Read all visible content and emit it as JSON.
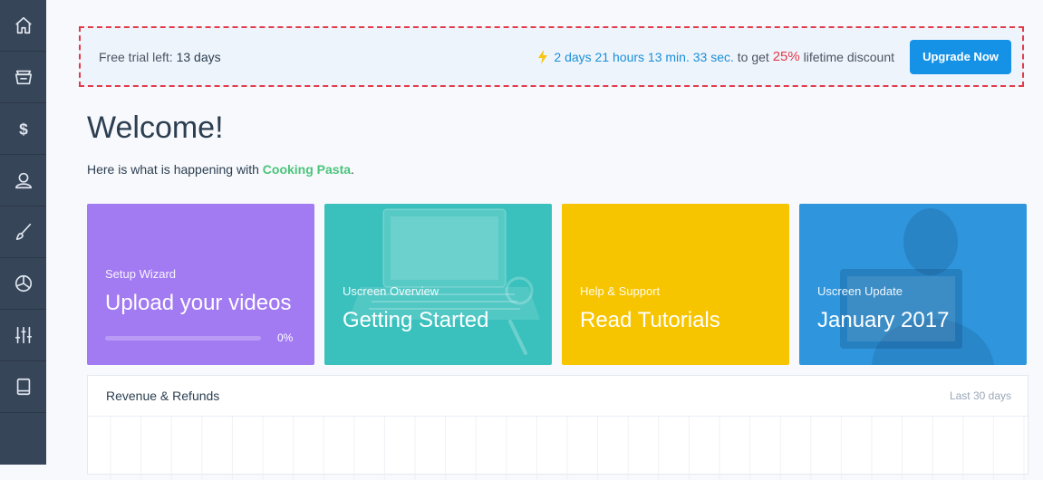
{
  "sidebar": {
    "items": [
      {
        "name": "home",
        "icon": "home-icon"
      },
      {
        "name": "catalog",
        "icon": "basket-icon"
      },
      {
        "name": "sales",
        "icon": "dollar-icon"
      },
      {
        "name": "people",
        "icon": "user-icon"
      },
      {
        "name": "design",
        "icon": "brush-icon"
      },
      {
        "name": "analytics",
        "icon": "pie-chart-icon"
      },
      {
        "name": "settings",
        "icon": "sliders-icon"
      },
      {
        "name": "apps",
        "icon": "tablet-icon"
      }
    ]
  },
  "trial": {
    "label": "Free trial left:",
    "days": "13 days",
    "countdown": "2 days 21 hours 13 min. 33 sec.",
    "to_get": "to get",
    "discount": "25%",
    "discount_suffix": "lifetime discount",
    "upgrade_label": "Upgrade Now"
  },
  "welcome": {
    "title": "Welcome!",
    "subtitle_prefix": "Here is what is happening with",
    "channel": "Cooking Pasta",
    "subtitle_suffix": "."
  },
  "cards": [
    {
      "overline": "Setup Wizard",
      "title": "Upload your videos",
      "progress": 0,
      "progress_label": "0%",
      "color": "#a27af2"
    },
    {
      "overline": "Uscreen Overview",
      "title": "Getting Started",
      "color": "#3bc1bd"
    },
    {
      "overline": "Help & Support",
      "title": "Read Tutorials",
      "color": "#f7c500"
    },
    {
      "overline": "Uscreen Update",
      "title": "January 2017",
      "color": "#2f96dd"
    }
  ],
  "revenue": {
    "title": "Revenue & Refunds",
    "range": "Last 30 days"
  },
  "colors": {
    "accent": "#1592e6",
    "danger": "#e23b4b",
    "brand_green": "#4cc47c",
    "sidebar": "#374559"
  }
}
